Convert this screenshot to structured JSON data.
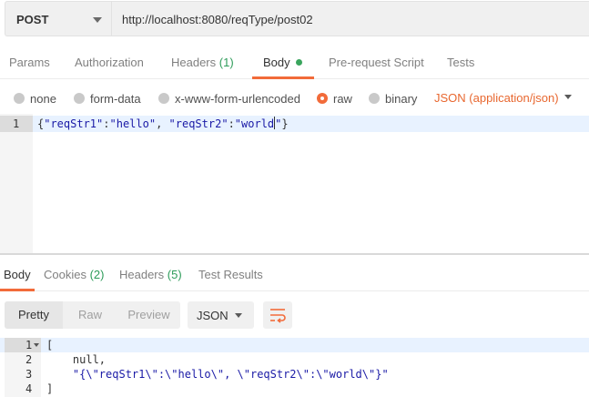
{
  "request": {
    "method": "POST",
    "url": "http://localhost:8080/reqType/post02"
  },
  "request_tabs": {
    "params": "Params",
    "authorization": "Authorization",
    "headers": "Headers",
    "headers_count": "(1)",
    "body": "Body",
    "pre_request": "Pre-request Script",
    "tests": "Tests"
  },
  "body_types": {
    "none": "none",
    "form_data": "form-data",
    "urlencoded": "x-www-form-urlencoded",
    "raw": "raw",
    "binary": "binary",
    "selected": "raw",
    "content_type": "JSON (application/json)"
  },
  "request_body": {
    "line_number": "1",
    "p1": "{",
    "k1": "\"reqStr1\"",
    "p2": ":",
    "v1": "\"hello\"",
    "p3": ", ",
    "k2": "\"reqStr2\"",
    "p4": ":",
    "v2a": "\"world",
    "v2b": "\"",
    "p5": "}"
  },
  "response_tabs": {
    "body": "Body",
    "cookies": "Cookies",
    "cookies_count": "(2)",
    "headers": "Headers",
    "headers_count": "(5)",
    "test_results": "Test Results"
  },
  "response_toolbar": {
    "pretty": "Pretty",
    "raw": "Raw",
    "preview": "Preview",
    "format": "JSON",
    "wrap_icon": "wrap-lines-icon"
  },
  "response_body": {
    "lines": [
      {
        "num": "1",
        "text": "["
      },
      {
        "num": "2",
        "text": "    null,"
      },
      {
        "num": "3",
        "text": "    \"{\\\"reqStr1\\\":\\\"hello\\\", \\\"reqStr2\\\":\\\"world\\\"}\""
      },
      {
        "num": "4",
        "text": "]"
      }
    ]
  },
  "colors": {
    "accent": "#f26b3a",
    "content_type": "#e8672f",
    "count_green": "#2e9c5a",
    "string_blue": "#1a1aa6"
  }
}
